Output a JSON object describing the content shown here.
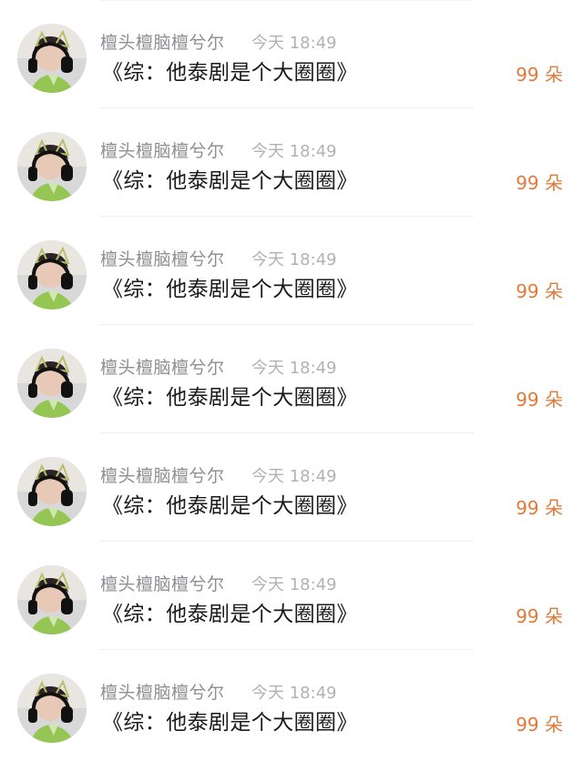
{
  "comments": [
    {
      "username": "檀头檀脑檀兮尔",
      "time": "今天 18:49",
      "title": "《综：他泰剧是个大圈圈》",
      "gift": "99 朵",
      "avatar": "user-avatar"
    },
    {
      "username": "檀头檀脑檀兮尔",
      "time": "今天 18:49",
      "title": "《综：他泰剧是个大圈圈》",
      "gift": "99 朵",
      "avatar": "user-avatar"
    },
    {
      "username": "檀头檀脑檀兮尔",
      "time": "今天 18:49",
      "title": "《综：他泰剧是个大圈圈》",
      "gift": "99 朵",
      "avatar": "user-avatar"
    },
    {
      "username": "檀头檀脑檀兮尔",
      "time": "今天 18:49",
      "title": "《综：他泰剧是个大圈圈》",
      "gift": "99 朵",
      "avatar": "user-avatar"
    },
    {
      "username": "檀头檀脑檀兮尔",
      "time": "今天 18:49",
      "title": "《综：他泰剧是个大圈圈》",
      "gift": "99 朵",
      "avatar": "user-avatar"
    },
    {
      "username": "檀头檀脑檀兮尔",
      "time": "今天 18:49",
      "title": "《综：他泰剧是个大圈圈》",
      "gift": "99 朵",
      "avatar": "user-avatar"
    },
    {
      "username": "檀头檀脑檀兮尔",
      "time": "今天 18:49",
      "title": "《综：他泰剧是个大圈圈》",
      "gift": "99 朵",
      "avatar": "user-avatar"
    }
  ],
  "colors": {
    "username": "#8e8e93",
    "time": "#b2b2b2",
    "title": "#1a1a1a",
    "gift": "#e07a3a",
    "divider": "#f0f0f0"
  }
}
